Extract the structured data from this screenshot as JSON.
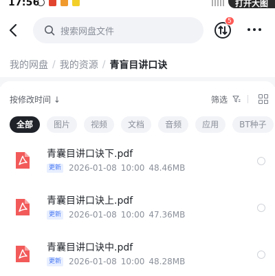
{
  "status_bar": {
    "time": "17:56",
    "open_app_label": "打开大图"
  },
  "header": {
    "search_placeholder": "搜索网盘文件",
    "transfer_badge": "5"
  },
  "breadcrumb": {
    "items": [
      "我的网盘",
      "我的资源"
    ],
    "current": "青盲目讲口诀"
  },
  "toolbar": {
    "sort_label": "按修改时间 ↓",
    "filter_label": "筛选"
  },
  "chips": [
    {
      "label": "全部",
      "active": true
    },
    {
      "label": "图片",
      "active": false
    },
    {
      "label": "视频",
      "active": false
    },
    {
      "label": "文档",
      "active": false
    },
    {
      "label": "音频",
      "active": false
    },
    {
      "label": "应用",
      "active": false
    },
    {
      "label": "BT种子",
      "active": false
    }
  ],
  "files": [
    {
      "name": "青囊目讲口诀下.pdf",
      "tag": "更新",
      "date": "2026-01-08",
      "time": "10:00",
      "size": "48.46MB"
    },
    {
      "name": "青囊目讲口诀上.pdf",
      "tag": "更新",
      "date": "2026-01-08",
      "time": "10:00",
      "size": "47.36MB"
    },
    {
      "name": "青囊目讲口诀中.pdf",
      "tag": "更新",
      "date": "2026-01-08",
      "time": "10:00",
      "size": "48.28MB"
    }
  ],
  "colors": {
    "pdf_icon": "#f25a5a",
    "accent": "#4c7bf3",
    "badge": "#ff5a55"
  },
  "icons": {
    "back": "back-arrow-icon",
    "search": "search-icon",
    "transfer": "transfer-icon",
    "more": "more-icon",
    "filter": "filter-icon",
    "grid": "grid-view-icon",
    "file": "pdf-file-icon"
  }
}
